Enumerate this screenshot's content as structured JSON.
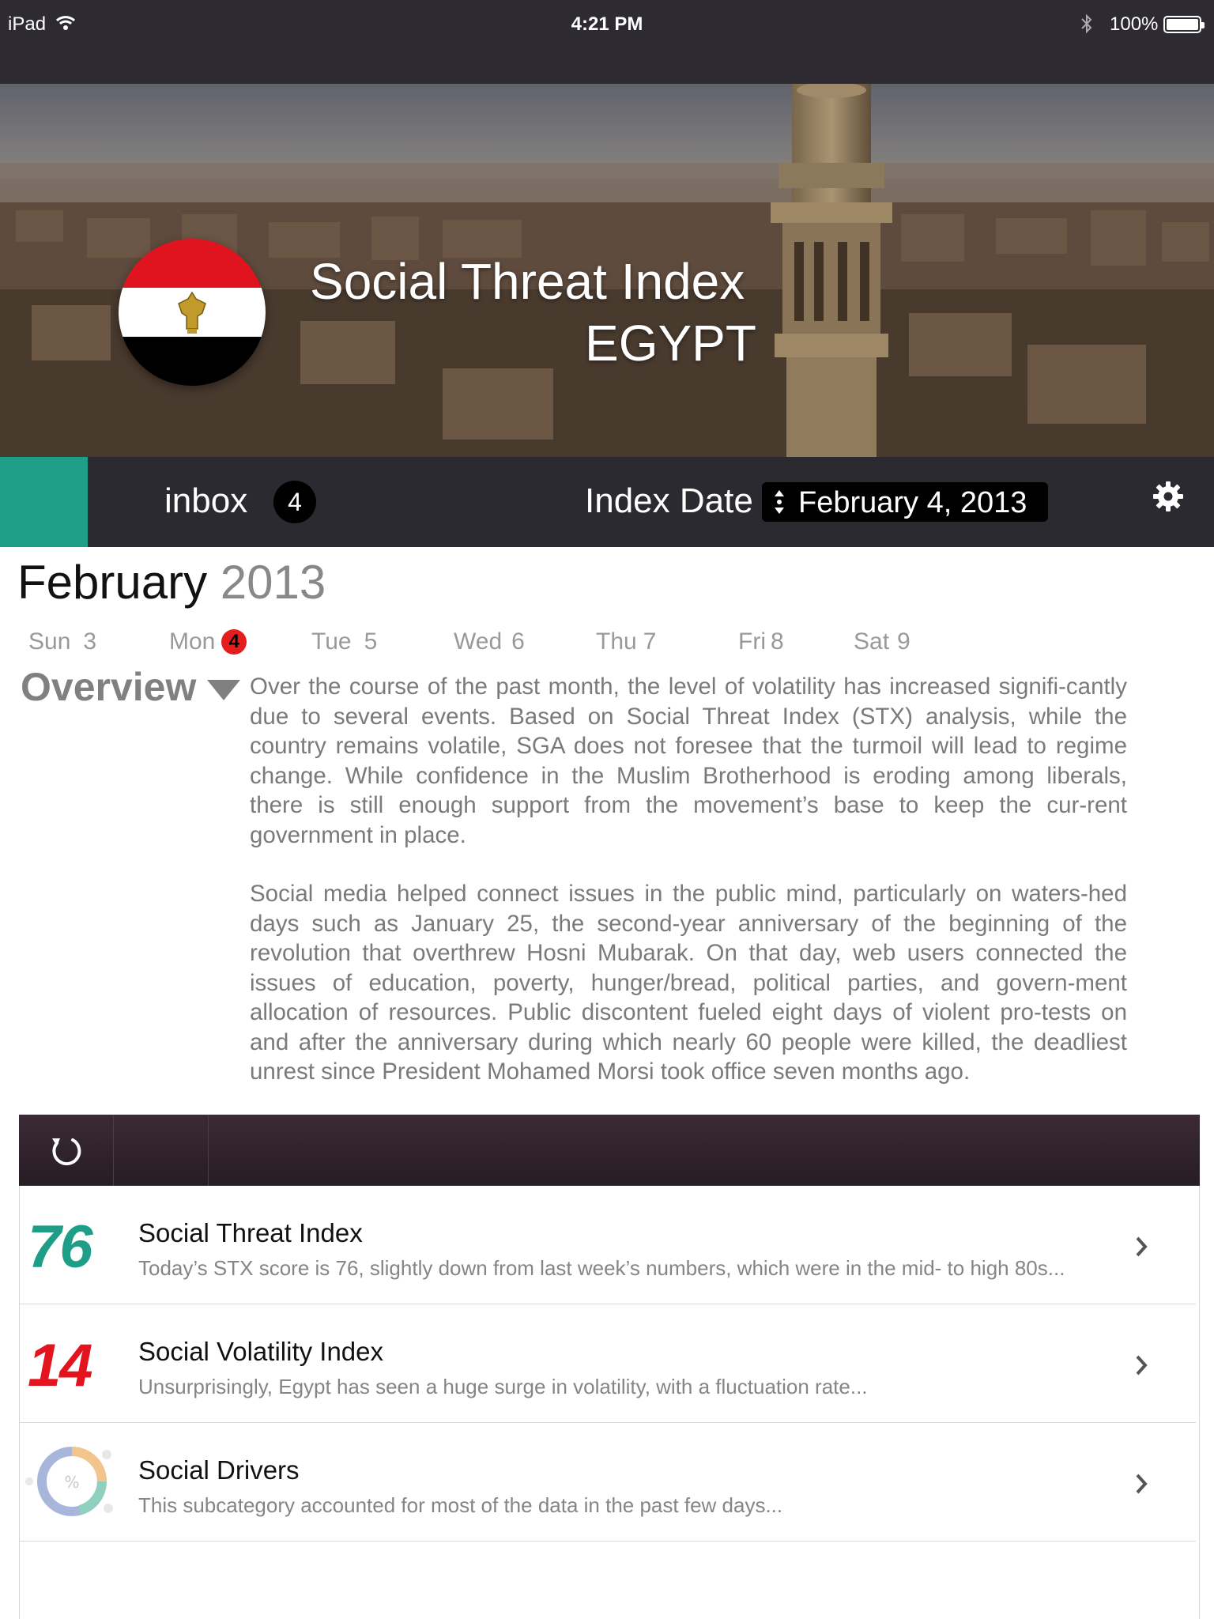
{
  "status_bar": {
    "carrier": "iPad",
    "time": "4:21 PM",
    "battery": "100%"
  },
  "hero": {
    "title": "Social Threat Index",
    "country": "EGYPT"
  },
  "nav": {
    "inbox_label": "inbox",
    "inbox_count": "4",
    "index_date_label": "Index Date",
    "index_date_value": "February 4, 2013"
  },
  "calendar": {
    "month": "February",
    "year": "2013",
    "days": [
      {
        "name": "Sun",
        "num": "3"
      },
      {
        "name": "Mon",
        "num": "4"
      },
      {
        "name": "Tue",
        "num": "5"
      },
      {
        "name": "Wed",
        "num": "6"
      },
      {
        "name": "Thu",
        "num": "7"
      },
      {
        "name": "Fri",
        "num": "8"
      },
      {
        "name": "Sat",
        "num": "9"
      }
    ]
  },
  "overview": {
    "title": "Overview",
    "paragraphs": [
      "Over the course of the past month, the level of volatility has increased signifi-cantly due to several events. Based on Social Threat Index (STX) analysis, while the country remains volatile, SGA does not foresee that the turmoil will lead to regime change. While confidence in the Muslim Brotherhood is eroding among liberals, there is still enough support from the movement’s base to keep the cur-rent government in place.",
      "Social media helped connect issues in the public mind, particularly on waters-hed days such as January 25, the second-year anniversary of the beginning of the revolution that overthrew Hosni Mubarak. On that day, web users connected the issues of education, poverty, hunger/bread, political parties, and govern-ment allocation of resources. Public discontent fueled eight days of violent pro-tests on and after the anniversary during which nearly 60 people were killed, the deadliest unrest since President Mohamed Morsi took office seven months ago."
    ]
  },
  "list": {
    "items": [
      {
        "badge": "76",
        "badge_color": "#1f9e87",
        "title": "Social Threat Index",
        "desc": "Today’s STX score is 76, slightly down from last week’s numbers, which were in the mid- to high 80s..."
      },
      {
        "badge": "14",
        "badge_color": "#e3141e",
        "title": "Social Volatility Index",
        "desc": "Unsurprisingly, Egypt has seen a huge surge in volatility, with a fluctuation rate..."
      },
      {
        "badge_icon": "donut-percent-icon",
        "badge_symbol": "%",
        "title": "Social Drivers",
        "desc": "This subcategory accounted for most of the data in the past few days..."
      }
    ]
  },
  "colors": {
    "accent": "#1f9e87",
    "alert": "#e3141e",
    "navbar": "#2b2a30",
    "toolbar": "#2f232b"
  }
}
